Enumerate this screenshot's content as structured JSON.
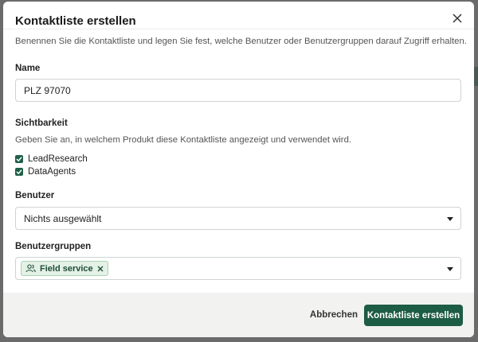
{
  "modal": {
    "title": "Kontaktliste erstellen",
    "description": "Benennen Sie die Kontaktliste und legen Sie fest, welche Benutzer oder Benutzergruppen darauf Zugriff erhalten."
  },
  "name_field": {
    "label": "Name",
    "value": "PLZ 97070"
  },
  "visibility": {
    "label": "Sichtbarkeit",
    "helper": "Geben Sie an, in welchem Produkt diese Kontaktliste angezeigt und verwendet wird.",
    "options": [
      {
        "label": "LeadResearch",
        "checked": true
      },
      {
        "label": "DataAgents",
        "checked": true
      }
    ]
  },
  "users_field": {
    "label": "Benutzer",
    "value": "Nichts ausgewählt"
  },
  "groups_field": {
    "label": "Benutzergruppen",
    "chips": [
      {
        "label": "Field service",
        "icon": "users-icon"
      }
    ]
  },
  "footer": {
    "cancel_label": "Abbrechen",
    "submit_label": "Kontaktliste erstellen"
  },
  "colors": {
    "primary": "#1d5c45",
    "chip_bg": "#e4f1e6",
    "checkbox": "#1f6048"
  }
}
